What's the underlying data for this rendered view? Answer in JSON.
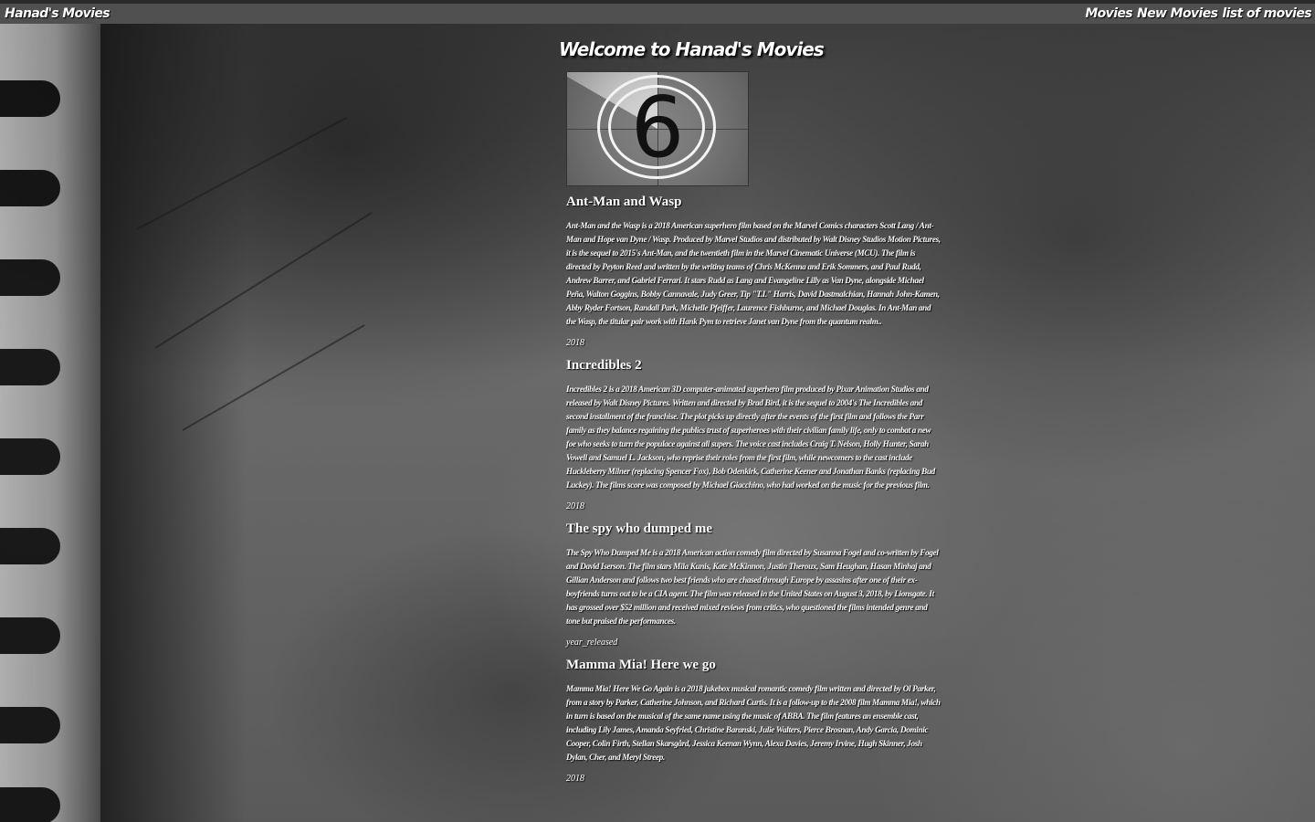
{
  "navbar": {
    "brand": "Hanad's Movies",
    "links": [
      "Movies",
      "New Movies",
      "list of movies"
    ]
  },
  "main": {
    "title": "Welcome to Hanad's Movies",
    "image_alt": "6"
  },
  "movies": [
    {
      "title": "Ant-Man and Wasp",
      "description": "Ant-Man and the Wasp is a 2018 American superhero film based on the Marvel Comics characters Scott Lang / Ant-Man and Hope van Dyne / Wasp. Produced by Marvel Studios and distributed by Walt Disney Studios Motion Pictures, it is the sequel to 2015's Ant-Man, and the twentieth film in the Marvel Cinematic Universe (MCU). The film is directed by Peyton Reed and written by the writing teams of Chris McKenna and Erik Sommers, and Paul Rudd, Andrew Barrer, and Gabriel Ferrari. It stars Rudd as Lang and Evangeline Lilly as Van Dyne, alongside Michael Peña, Walton Goggins, Bobby Cannavale, Judy Greer, Tip \"T.I.\" Harris, David Dastmalchian, Hannah John-Kamen, Abby Ryder Fortson, Randall Park, Michelle Pfeiffer, Laurence Fishburne, and Michael Douglas. In Ant-Man and the Wasp, the titular pair work with Hank Pym to retrieve Janet van Dyne from the quantum realm..",
      "year": "2018"
    },
    {
      "title": "Incredibles 2",
      "description": "Incredibles 2 is a 2018 American 3D computer-animated superhero film produced by Pixar Animation Studios and released by Walt Disney Pictures. Written and directed by Brad Bird, it is the sequel to 2004's The Incredibles and second installment of the franchise. The plot picks up directly after the events of the first film and follows the Parr family as they balance regaining the publics trust of superheroes with their civilian family life, only to combat a new foe who seeks to turn the populace against all supers. The voice cast includes Craig T. Nelson, Holly Hunter, Sarah Vowell and Samuel L. Jackson, who reprise their roles from the first film, while newcomers to the cast include Huckleberry Milner (replacing Spencer Fox), Bob Odenkirk, Catherine Keener and Jonathan Banks (replacing Bud Luckey). The films score was composed by Michael Giacchino, who had worked on the music for the previous film.",
      "year": "2018"
    },
    {
      "title": "The spy who dumped me",
      "description": "The Spy Who Dumped Me is a 2018 American action comedy film directed by Susanna Fogel and co-written by Fogel and David Iserson. The film stars Mila Kunis, Kate McKinnon, Justin Theroux, Sam Heughan, Hasan Minhaj and Gillian Anderson and follows two best friends who are chased through Europe by assasins after one of their ex-boyfriends turns out to be a CIA agent. The film was released in the United States on August 3, 2018, by Lionsgate. It has grossed over $52 million and received mixed reviews from critics, who questioned the films intended genre and tone but praised the performances.",
      "year": "year_released"
    },
    {
      "title": "Mamma Mia! Here we go",
      "description": "Mamma Mia! Here We Go Again is a 2018 jukebox musical romantic comedy film written and directed by Ol Parker, from a story by Parker, Catherine Johnson, and Richard Curtis. It is a follow-up to the 2008 film Mamma Mia!, which in turn is based on the musical of the same name using the music of ABBA. The film features an ensemble cast, including Lily James, Amanda Seyfried, Christine Baranski, Julie Walters, Pierce Brosnan, Andy Garcia, Dominic Cooper, Colin Firth, Stellan Skarsgård, Jessica Keenan Wynn, Alexa Davies, Jeremy Irvine, Hugh Skinner, Josh Dylan, Cher, and Meryl Streep.",
      "year": "2018"
    }
  ]
}
